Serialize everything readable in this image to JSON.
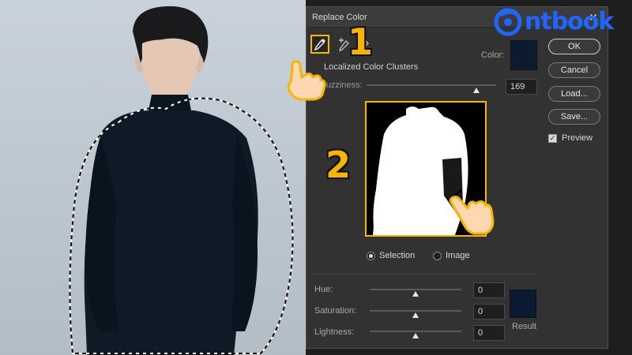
{
  "dialog": {
    "title": "Replace Color",
    "close_glyph": "✕",
    "localized_label": "Localized Color Clusters",
    "color_label": "Color:",
    "color_swatch_hex": "#0d1b2f",
    "fuzziness_label": "Fuzziness:",
    "fuzziness_value": "169",
    "fuzziness_level": 169,
    "radio_selection": "Selection",
    "radio_image": "Image",
    "selected_radio": "Selection",
    "hue_label": "Hue:",
    "hue_value": "0",
    "saturation_label": "Saturation:",
    "saturation_value": "0",
    "lightness_label": "Lightness:",
    "lightness_value": "0",
    "result_label": "Result",
    "result_swatch_hex": "#0b1a30"
  },
  "buttons": {
    "ok": "OK",
    "cancel": "Cancel",
    "load": "Load...",
    "save": "Save...",
    "preview": "Preview",
    "preview_checked": true
  },
  "annotations": {
    "step_1": "1",
    "step_2": "2",
    "accent": "#f7b500"
  },
  "logo": {
    "text": "ntbook",
    "color": "#1f66ff"
  },
  "icons": [
    "eyedropper-icon",
    "eyedropper-plus-icon",
    "eyedropper-minus-icon",
    "close-icon",
    "pointing-hand-icon",
    "logo-icon"
  ]
}
